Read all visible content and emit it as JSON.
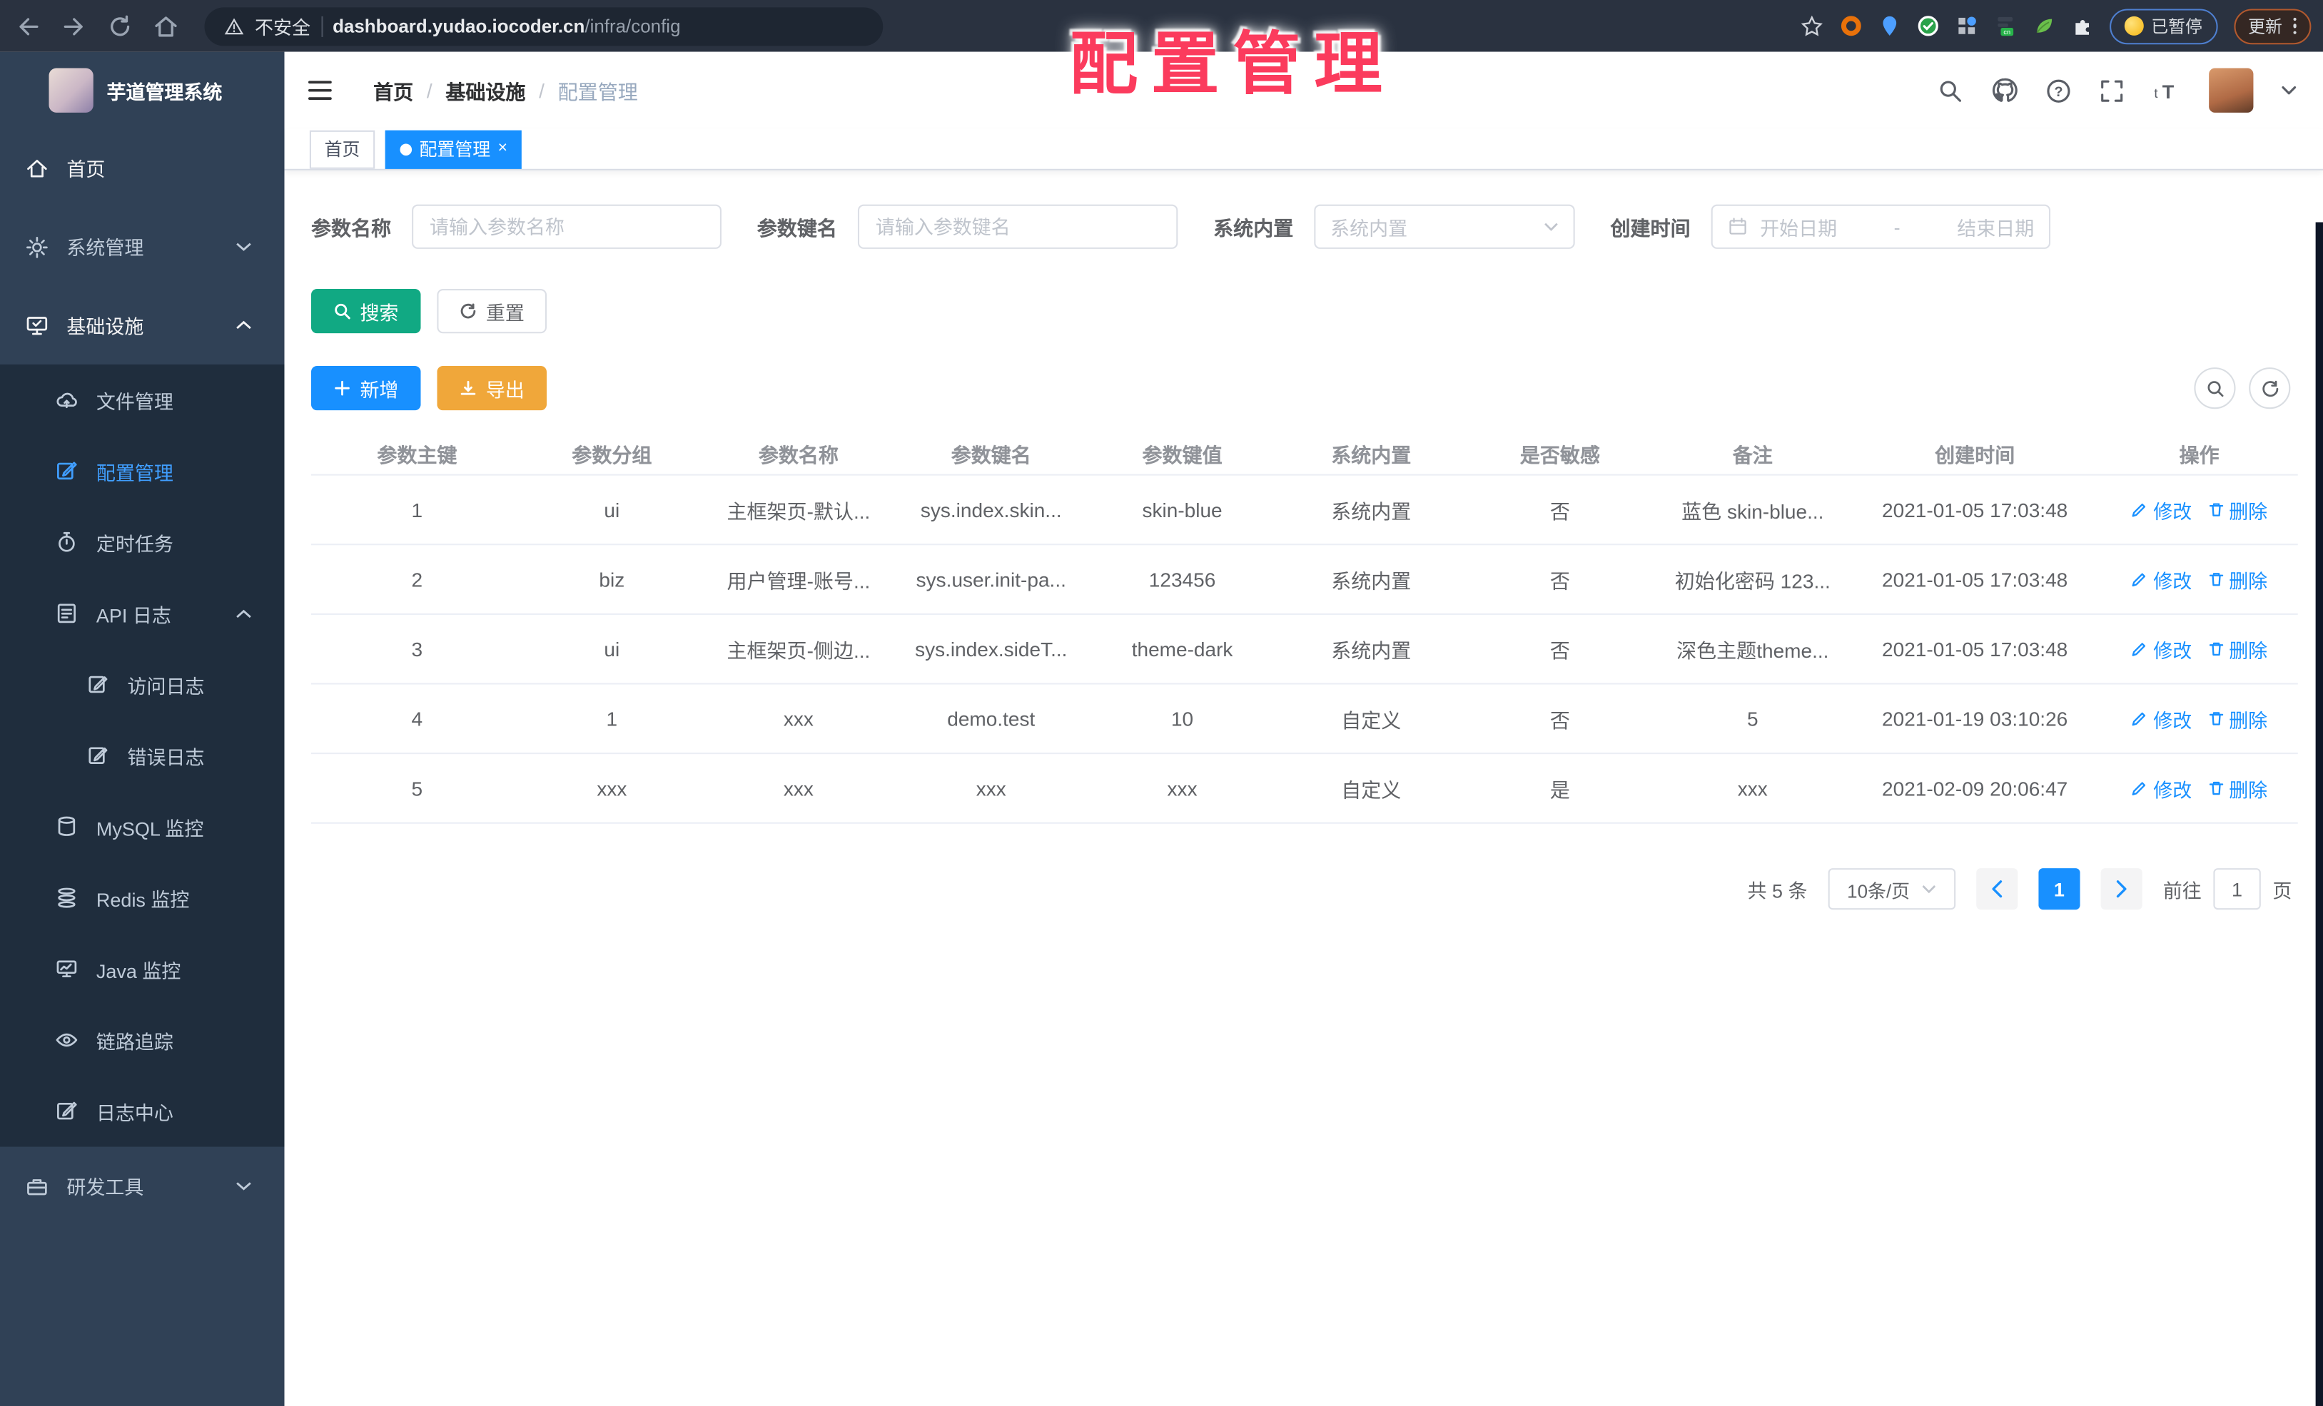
{
  "browser": {
    "insecure_label": "不安全",
    "url_host": "dashboard.yudao.iocoder.cn",
    "url_path": "/infra/config",
    "ext_badge": "cn",
    "paused_label": "已暂停",
    "update_label": "更新"
  },
  "overlay_title": "配置管理",
  "sidebar": {
    "title": "芋道管理系统",
    "items": [
      {
        "label": "首页"
      },
      {
        "label": "系统管理"
      },
      {
        "label": "基础设施"
      },
      {
        "label": "文件管理"
      },
      {
        "label": "配置管理"
      },
      {
        "label": "定时任务"
      },
      {
        "label": "API 日志"
      },
      {
        "label": "访问日志"
      },
      {
        "label": "错误日志"
      },
      {
        "label": "MySQL 监控"
      },
      {
        "label": "Redis 监控"
      },
      {
        "label": "Java 监控"
      },
      {
        "label": "链路追踪"
      },
      {
        "label": "日志中心"
      },
      {
        "label": "研发工具"
      }
    ]
  },
  "header": {
    "breadcrumb": [
      "首页",
      "基础设施",
      "配置管理"
    ],
    "sep": "/"
  },
  "tabs": [
    {
      "label": "首页"
    },
    {
      "label": "配置管理",
      "close": "×"
    }
  ],
  "filters": {
    "name_label": "参数名称",
    "name_placeholder": "请输入参数名称",
    "key_label": "参数键名",
    "key_placeholder": "请输入参数键名",
    "type_label": "系统内置",
    "type_placeholder": "系统内置",
    "date_label": "创建时间",
    "date_start": "开始日期",
    "date_sep": "-",
    "date_end": "结束日期"
  },
  "buttons": {
    "search": "搜索",
    "reset": "重置",
    "add": "新增",
    "export": "导出"
  },
  "table": {
    "headers": [
      "参数主键",
      "参数分组",
      "参数名称",
      "参数键名",
      "参数键值",
      "系统内置",
      "是否敏感",
      "备注",
      "创建时间",
      "操作"
    ],
    "ops": {
      "edit": "修改",
      "delete": "删除"
    },
    "rows": [
      {
        "cells": [
          "1",
          "ui",
          "主框架页-默认...",
          "sys.index.skin...",
          "skin-blue",
          "系统内置",
          "否",
          "蓝色 skin-blue...",
          "2021-01-05 17:03:48"
        ]
      },
      {
        "cells": [
          "2",
          "biz",
          "用户管理-账号...",
          "sys.user.init-pa...",
          "123456",
          "系统内置",
          "否",
          "初始化密码 123...",
          "2021-01-05 17:03:48"
        ]
      },
      {
        "cells": [
          "3",
          "ui",
          "主框架页-侧边...",
          "sys.index.sideT...",
          "theme-dark",
          "系统内置",
          "否",
          "深色主题theme...",
          "2021-01-05 17:03:48"
        ]
      },
      {
        "cells": [
          "4",
          "1",
          "xxx",
          "demo.test",
          "10",
          "自定义",
          "否",
          "5",
          "2021-01-19 03:10:26"
        ]
      },
      {
        "cells": [
          "5",
          "xxx",
          "xxx",
          "xxx",
          "xxx",
          "自定义",
          "是",
          "xxx",
          "2021-02-09 20:06:47"
        ]
      }
    ]
  },
  "pagination": {
    "total_label": "共 5 条",
    "page_size_label": "10条/页",
    "current": "1",
    "goto_label": "前往",
    "goto_value": "1",
    "page_unit": "页"
  }
}
